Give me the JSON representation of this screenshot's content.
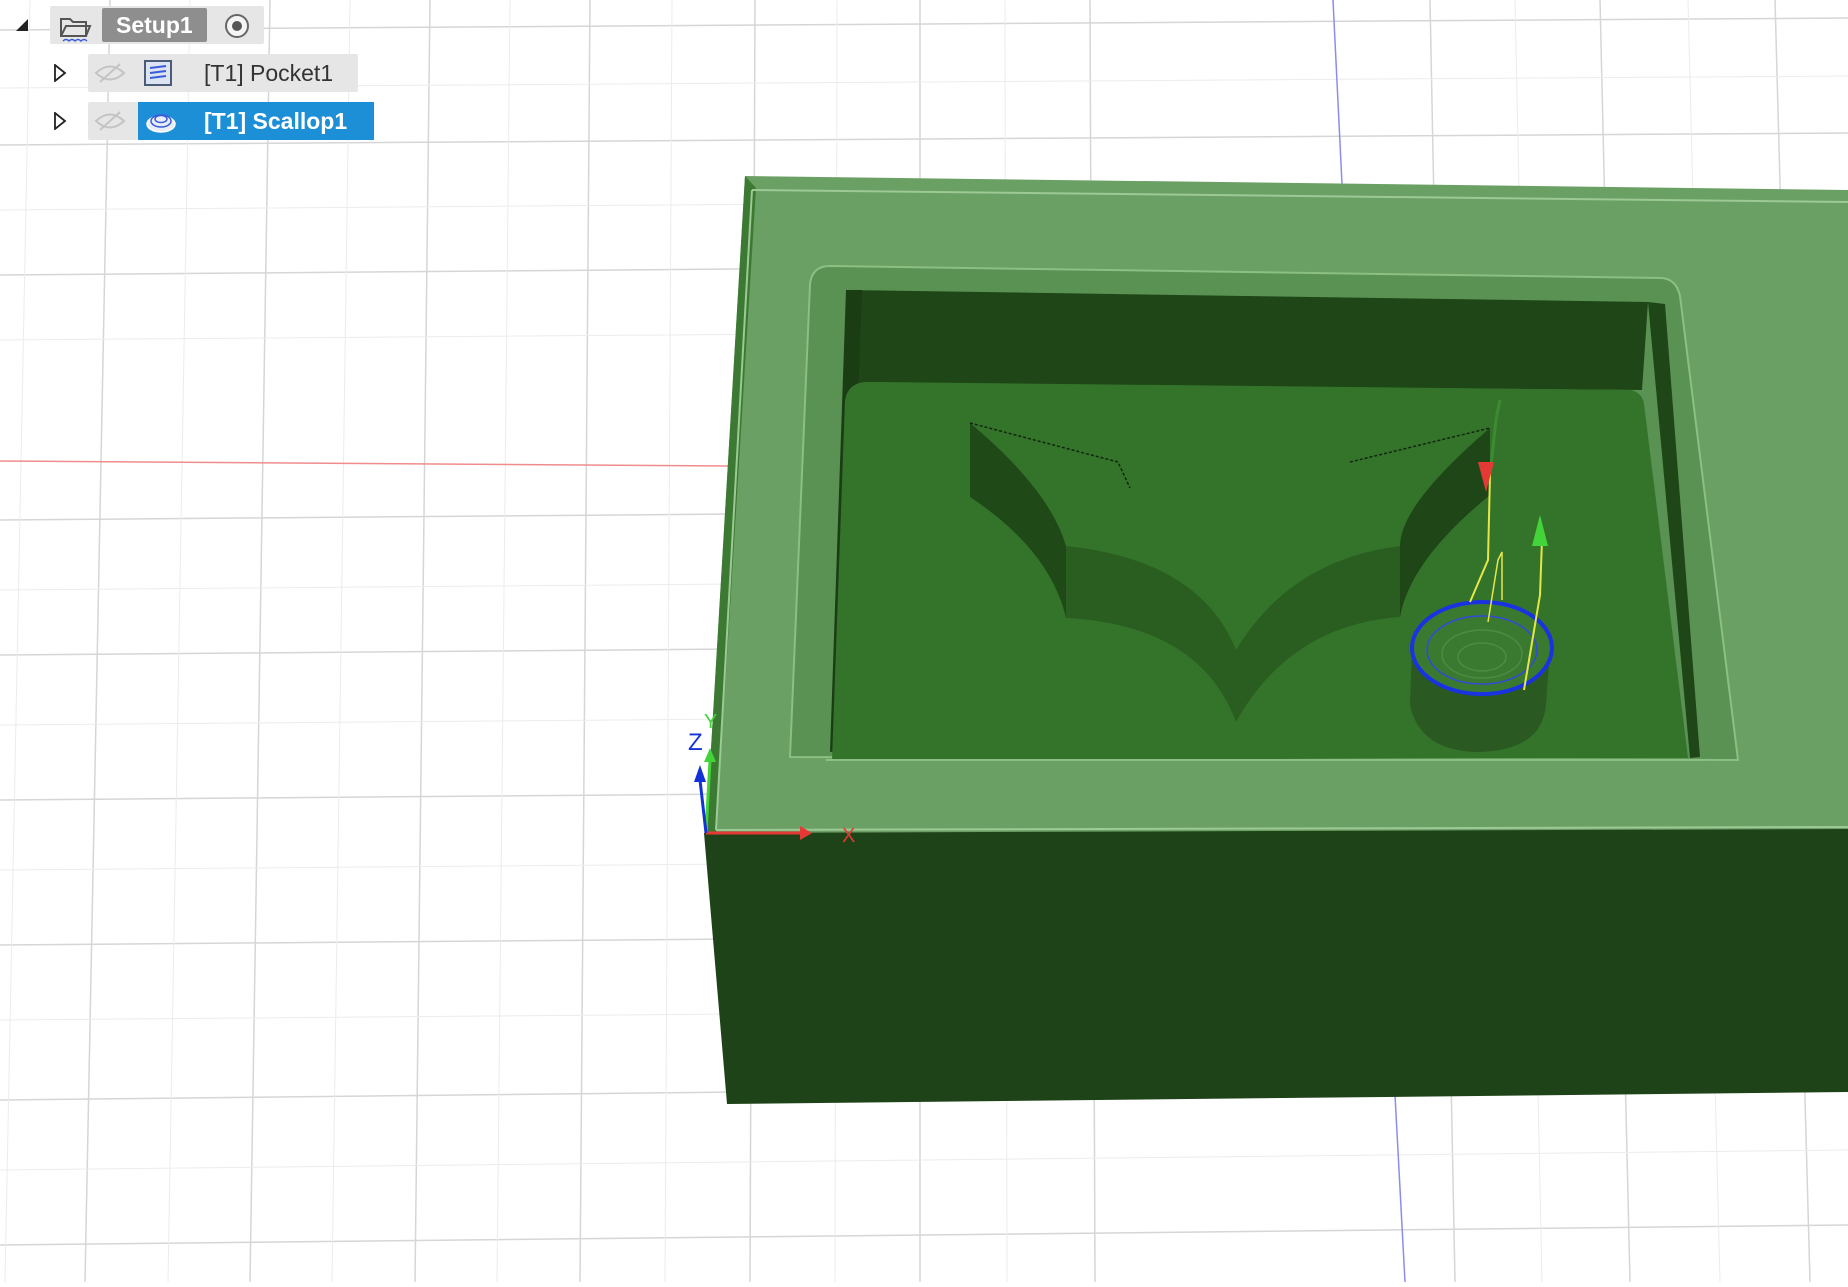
{
  "browser": {
    "setup": {
      "label": "Setup1",
      "expanded": true,
      "folder_icon": "folder-open-icon",
      "activation_icon": "radio-target-icon"
    },
    "operations": [
      {
        "label": "[T1] Pocket1",
        "expanded": false,
        "selected": false,
        "visibility_icon": "eye-hidden-icon",
        "type_icon": "pocket-toolpath-icon"
      },
      {
        "label": "[T1] Scallop1",
        "expanded": false,
        "selected": true,
        "visibility_icon": "eye-hidden-icon",
        "type_icon": "scallop-toolpath-icon"
      }
    ]
  },
  "triad": {
    "x_label": "X",
    "y_label": "Y",
    "z_label": "Z"
  },
  "colors": {
    "selection": "#1d8fd6",
    "stock_top": "#6aa063",
    "stock_side": "#1f4318",
    "pocket_floor": "#34742a",
    "pocket_wall": "#1e4617",
    "grid": "#d6d6d6",
    "axis_x": "#e53935",
    "axis_y": "#43d43a",
    "axis_z": "#1433d6",
    "tool_outline": "#1a33e0"
  }
}
